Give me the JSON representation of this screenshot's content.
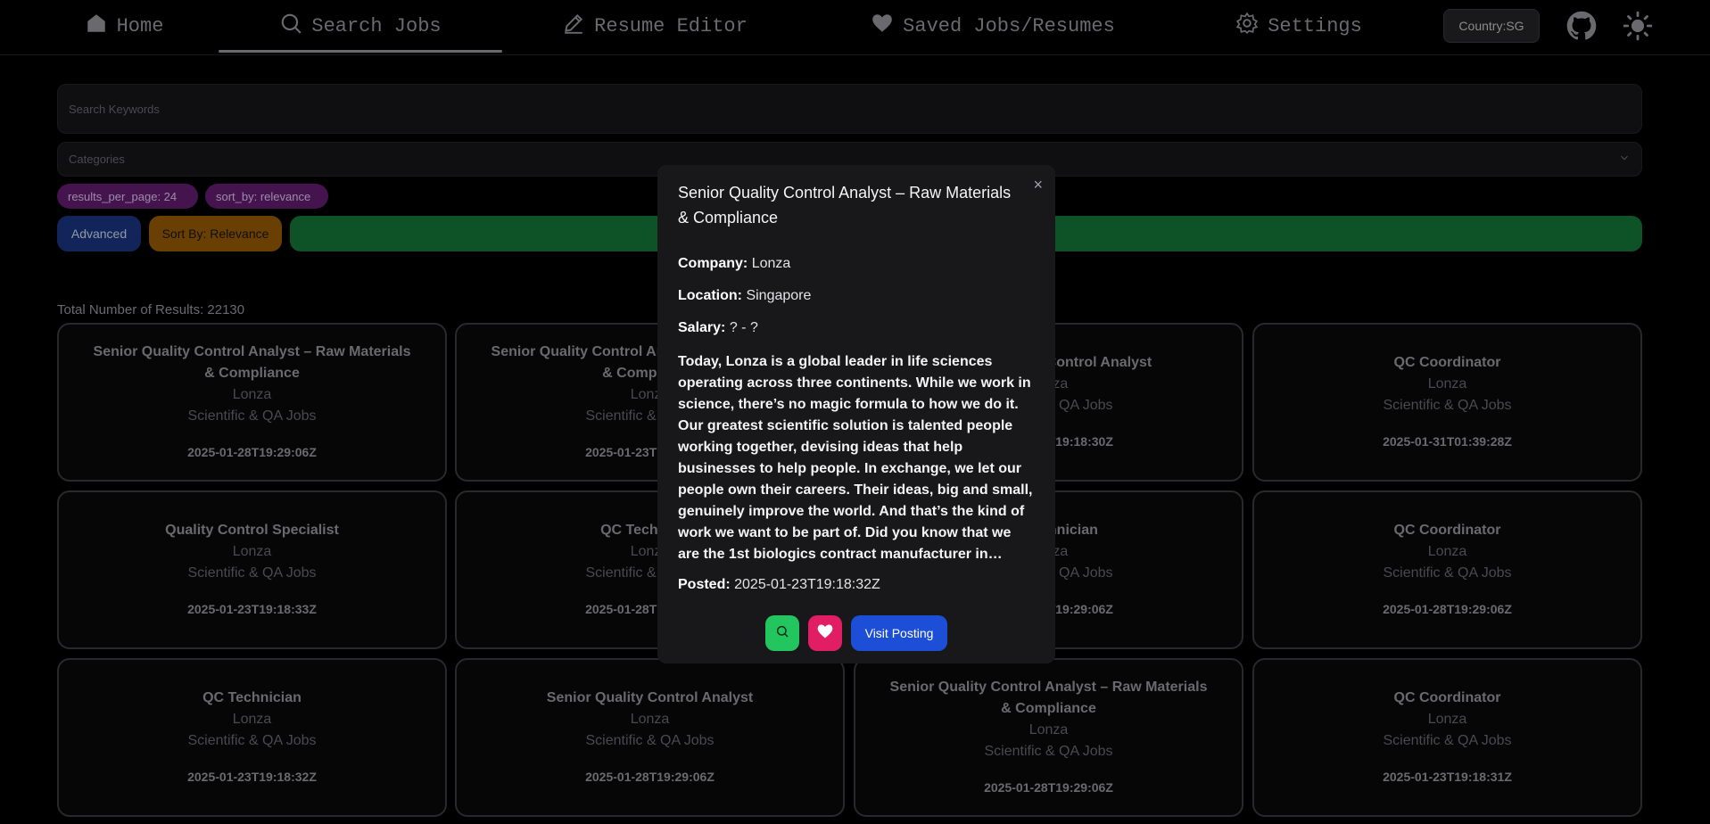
{
  "nav": {
    "home": "Home",
    "search_jobs": "Search Jobs",
    "resume_editor": "Resume Editor",
    "saved": "Saved Jobs/Resumes",
    "settings": "Settings",
    "country": "Country:SG"
  },
  "search": {
    "keywords_placeholder": "Search Keywords",
    "categories_placeholder": "Categories",
    "chips": [
      "results_per_page: 24",
      "sort_by: relevance"
    ],
    "advanced": "Advanced",
    "sort": "Sort By: Relevance",
    "total": "Total Number of Results: 22130"
  },
  "cards": [
    {
      "title": "Senior Quality Control Analyst – Raw Materials & Compliance",
      "company": "Lonza",
      "category": "Scientific & QA Jobs",
      "date": "2025-01-28T19:29:06Z"
    },
    {
      "title": "Senior Quality Control Analyst – Raw Materials & Compliance",
      "company": "Lonza",
      "category": "Scientific & QA Jobs",
      "date": "2025-01-23T19:18:32Z"
    },
    {
      "title": "Senior Quality Control Analyst",
      "company": "Lonza",
      "category": "Scientific & QA Jobs",
      "date": "2025-01-23T19:18:30Z"
    },
    {
      "title": "QC Coordinator",
      "company": "Lonza",
      "category": "Scientific & QA Jobs",
      "date": "2025-01-31T01:39:28Z"
    },
    {
      "title": "Quality Control Specialist",
      "company": "Lonza",
      "category": "Scientific & QA Jobs",
      "date": "2025-01-23T19:18:33Z"
    },
    {
      "title": "QC Technician",
      "company": "Lonza",
      "category": "Scientific & QA Jobs",
      "date": "2025-01-28T19:29:06Z"
    },
    {
      "title": "QC Technician",
      "company": "Lonza",
      "category": "Scientific & QA Jobs",
      "date": "2025-01-28T19:29:06Z"
    },
    {
      "title": "QC Coordinator",
      "company": "Lonza",
      "category": "Scientific & QA Jobs",
      "date": "2025-01-28T19:29:06Z"
    },
    {
      "title": "QC Technician",
      "company": "Lonza",
      "category": "Scientific & QA Jobs",
      "date": "2025-01-23T19:18:32Z"
    },
    {
      "title": "Senior Quality Control Analyst",
      "company": "Lonza",
      "category": "Scientific & QA Jobs",
      "date": "2025-01-28T19:29:06Z"
    },
    {
      "title": "Senior Quality Control Analyst – Raw Materials & Compliance",
      "company": "Lonza",
      "category": "Scientific & QA Jobs",
      "date": "2025-01-28T19:29:06Z"
    },
    {
      "title": "QC Coordinator",
      "company": "Lonza",
      "category": "Scientific & QA Jobs",
      "date": "2025-01-23T19:18:31Z"
    }
  ],
  "modal": {
    "close": "×",
    "title": "Senior Quality Control Analyst – Raw Materials & Compliance",
    "company_label": "Company:",
    "company": "Lonza",
    "location_label": "Location:",
    "location": "Singapore",
    "salary_label": "Salary:",
    "salary": "? - ?",
    "description": "Today, Lonza is a global leader in life sciences operating across three continents. While we work in science, there’s no magic formula to how we do it. Our greatest scientific solution is talented people working together, devising ideas that help businesses to help people. In exchange, we let our people own their careers. Their ideas, big and small, genuinely improve the world. And that’s the kind of work we want to be part of. Did you know that we are the 1st biologics contract manufacturer in…",
    "posted_label": "Posted:",
    "posted": "2025-01-23T19:18:32Z",
    "visit": "Visit Posting"
  },
  "colors": {
    "search_button": "#15803d",
    "advanced_button": "#1d3a8a",
    "sort_button": "#a16207",
    "chip": "#6b1f7a",
    "save_button": "#e11d63",
    "visit_button": "#1d4ed8"
  }
}
